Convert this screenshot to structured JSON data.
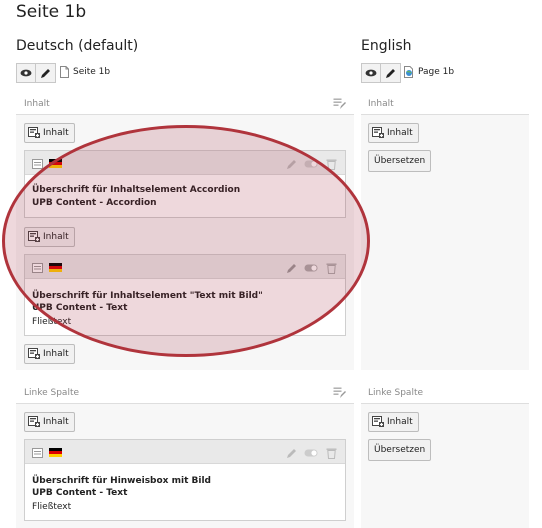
{
  "page": {
    "title": "Seite 1b"
  },
  "columns": {
    "default": {
      "language": "Deutsch (default)",
      "page_link": "Seite 1b",
      "sections": [
        {
          "label": "Inhalt",
          "add_label": "Inhalt",
          "elements": [
            {
              "headline": "Überschrift für Inhaltselement Accordion",
              "type": "UPB Content - Accordion",
              "body": ""
            },
            {
              "headline": "Überschrift für Inhaltselement \"Text mit Bild\"",
              "type": "UPB Content - Text",
              "body": "Fließtext"
            }
          ]
        },
        {
          "label": "Linke Spalte",
          "add_label": "Inhalt",
          "elements": [
            {
              "headline": "Überschrift für Hinweisbox mit Bild",
              "type": "UPB Content - Text",
              "body": "Fließtext"
            }
          ]
        }
      ]
    },
    "english": {
      "language": "English",
      "page_link": "Page 1b",
      "sections": [
        {
          "label": "Inhalt",
          "add_label": "Inhalt",
          "translate_label": "Übersetzen"
        },
        {
          "label": "Linke Spalte",
          "add_label": "Inhalt",
          "translate_label": "Übersetzen"
        }
      ]
    }
  },
  "icons": {
    "view": "eye-icon",
    "edit": "pencil-icon",
    "page": "page-icon",
    "add_content": "add-content-icon",
    "drag_handle": "drag-handle-icon",
    "language_flag": "german-flag-icon",
    "hide_toggle": "toggle-icon",
    "delete": "trash-icon",
    "section_edit": "section-edit-icon"
  },
  "colors": {
    "highlight": "#b0343c",
    "flag_black": "#000000",
    "flag_red": "#dd0000",
    "flag_gold": "#ffce00"
  }
}
